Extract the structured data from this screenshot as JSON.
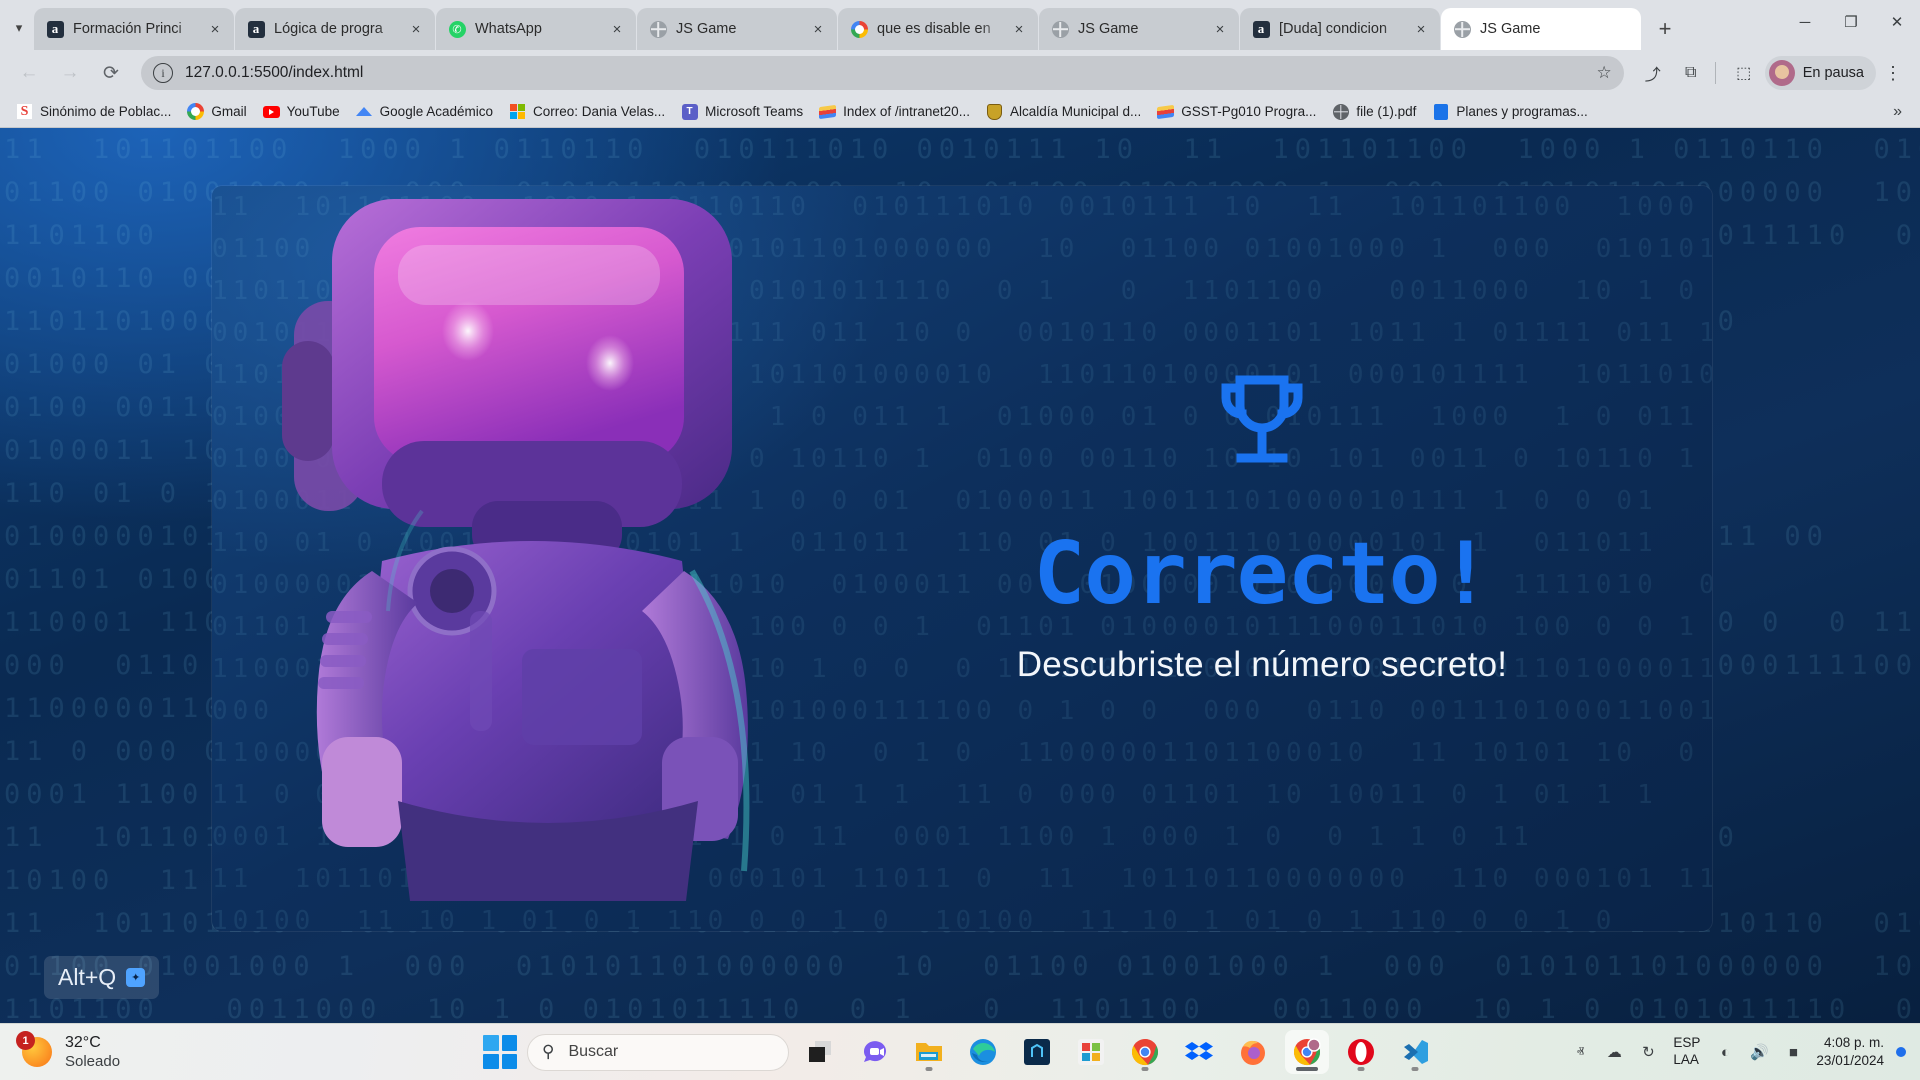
{
  "browser": {
    "tab_list_chevron_icon": "chevron-down-icon",
    "tabs": [
      {
        "title": "Formación Princi",
        "favicon": "amazon-icon",
        "active": false,
        "close_label": "×"
      },
      {
        "title": "Lógica de progra",
        "favicon": "amazon-icon",
        "active": false,
        "close_label": "×"
      },
      {
        "title": "WhatsApp",
        "favicon": "whatsapp-icon",
        "active": false,
        "close_label": "×"
      },
      {
        "title": "JS Game",
        "favicon": "globe-icon",
        "active": false,
        "close_label": "×"
      },
      {
        "title": "que es disable en",
        "favicon": "google-icon",
        "active": false,
        "close_label": "×"
      },
      {
        "title": "JS Game",
        "favicon": "globe-icon",
        "active": false,
        "close_label": "×"
      },
      {
        "title": "[Duda] condicion",
        "favicon": "amazon-icon",
        "active": false,
        "close_label": "×"
      },
      {
        "title": "JS Game",
        "favicon": "globe-icon",
        "active": true,
        "close_label": "×"
      }
    ],
    "new_tab_label": "+",
    "window_controls": {
      "minimize": "─",
      "maximize": "❐",
      "close": "✕"
    },
    "toolbar": {
      "back_label": "←",
      "forward_label": "→",
      "reload_label": "⟳",
      "site_info_label": "i",
      "url": "127.0.0.1:5500/index.html",
      "bookmark_star_label": "☆",
      "share_label": "⤴",
      "extensions_label": "⧉",
      "sidepanel_label": "⬚",
      "profile_label": "En pausa",
      "menu_label": "⋮"
    },
    "bookmarks": [
      {
        "label": "Sinónimo de Poblac...",
        "icon": "sinonimos-icon"
      },
      {
        "label": "Gmail",
        "icon": "gmail-icon"
      },
      {
        "label": "YouTube",
        "icon": "youtube-icon"
      },
      {
        "label": "Google Académico",
        "icon": "google-scholar-icon"
      },
      {
        "label": "Correo: Dania Velas...",
        "icon": "microsoft-icon"
      },
      {
        "label": "Microsoft Teams",
        "icon": "teams-icon"
      },
      {
        "label": "Index of /intranet20...",
        "icon": "wave-icon"
      },
      {
        "label": "Alcaldía Municipal d...",
        "icon": "shield-icon"
      },
      {
        "label": "GSST-Pg010 Progra...",
        "icon": "wave-icon"
      },
      {
        "label": "file (1).pdf",
        "icon": "globe-icon"
      },
      {
        "label": "Planes y programas...",
        "icon": "document-icon"
      }
    ],
    "bookmarks_overflow_label": "»"
  },
  "page": {
    "trophy_icon": "trophy-icon",
    "headline": "Correcto!",
    "subline": "Descubriste el número secreto!",
    "accent_color": "#1a73f0",
    "background_color": "#0a2448",
    "binary_rows": [
      "11  101101100  1000 1 0110110  010111010 0010111 10",
      "01100 01001000 1  000  010101101000000  10",
      "1101100   0011000  10 1 0 0101011110  0 1   0",
      "0010110 0001101 1011 1 01111 011 10 0",
      "11011010000101 000101111  101101000010",
      "01000 01 0 0 010111  1000  1 0 011 1",
      "0100 00110 10 10 101 0011 0 10110 1",
      "0100011 10011101000010111 1 0 0 01",
      "110 01 0 100111010000101 1  011011",
      "0100000101010000  0  1111010  0100011 00",
      "01101 0100001011100011010 100 0 0 1",
      "110001 11001 000011010000110 1 0 0  0 11 100",
      "000  0110 0011101000110011101000111100 0 1 0 0",
      "11000001101100010  11 10101 10  0 1 0",
      "11 0 000 01101 10 10011 0 1 01 1 1",
      "0001 1100 1 000 1 0  0 1 1 0 11",
      "11  10110110000000  110 000101 11011 0",
      "10100  11 10 1 01 0 1 110 0 0 1 0"
    ],
    "shortcut_hint": {
      "label": "Alt+Q",
      "badge_icon": "sparkle-icon"
    }
  },
  "taskbar": {
    "weather": {
      "temperature": "32°C",
      "condition": "Soleado",
      "badge_count": "1",
      "icon": "sun-icon"
    },
    "start_label": "start-icon",
    "search_placeholder": "Buscar",
    "search_icon": "search-icon",
    "apps": [
      {
        "name": "task-view-icon",
        "running": false
      },
      {
        "name": "chat-icon",
        "running": false
      },
      {
        "name": "file-explorer-icon",
        "running": true
      },
      {
        "name": "edge-icon",
        "running": false
      },
      {
        "name": "store-icon",
        "running": false
      },
      {
        "name": "office-icon",
        "running": false
      },
      {
        "name": "chrome-icon",
        "running": true
      },
      {
        "name": "dropbox-icon",
        "running": false
      },
      {
        "name": "firefox-icon",
        "running": false
      },
      {
        "name": "chrome-profile-icon",
        "running": true
      },
      {
        "name": "opera-icon",
        "running": true
      },
      {
        "name": "vscode-icon",
        "running": true
      }
    ],
    "tray": {
      "chevron_label": "ⱏ",
      "onedrive_icon": "cloud-icon",
      "update_icon": "update-icon",
      "network_icon": "wifi-icon",
      "volume_icon": "speaker-icon",
      "battery_icon": "battery-icon",
      "language_line1": "ESP",
      "language_line2": "LAA",
      "time": "4:08 p. m.",
      "date": "23/01/2024",
      "notification_icon": "notification-dot"
    }
  }
}
